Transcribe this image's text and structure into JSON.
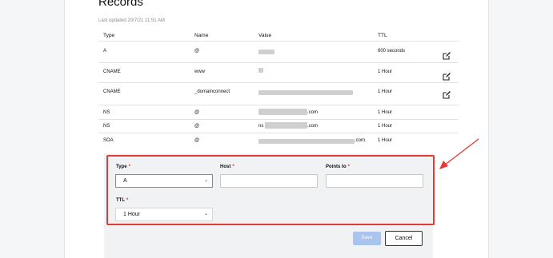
{
  "page": {
    "title": "Records",
    "last_updated": "Last updated 20/7/21 11:51 AM"
  },
  "table": {
    "headers": [
      "Type",
      "Name",
      "Value",
      "TTL"
    ],
    "rows": [
      {
        "type": "A",
        "name": "@",
        "value": "",
        "ttl": "600 seconds"
      },
      {
        "type": "CNAME",
        "name": "www",
        "value": "",
        "ttl": "1 Hour"
      },
      {
        "type": "CNAME",
        "name": "_domainconnect",
        "value": "",
        "ttl": "1 Hour"
      },
      {
        "type": "NS",
        "name": "@",
        "value": ".com",
        "ttl": "1 Hour"
      },
      {
        "type": "NS",
        "name": "@",
        "value": "ns    .com",
        "value_prefix": "ns",
        "value_suffix": ".com",
        "ttl": "1 Hour"
      },
      {
        "type": "SOA",
        "name": "@",
        "value": ".com.",
        "ttl": "1 Hour"
      }
    ],
    "edit_icon": "edit-icon"
  },
  "form": {
    "type_label": "Type",
    "type_value": "A",
    "host_label": "Host",
    "host_value": "",
    "points_to_label": "Points to",
    "points_to_value": "",
    "ttl_label": "TTL",
    "ttl_value": "1 Hour",
    "required_mark": "*",
    "save_label": "Save",
    "cancel_label": "Cancel"
  },
  "colors": {
    "highlight": "#e53935",
    "save_button": "#a9c4ef",
    "required": "#d32f2f"
  }
}
